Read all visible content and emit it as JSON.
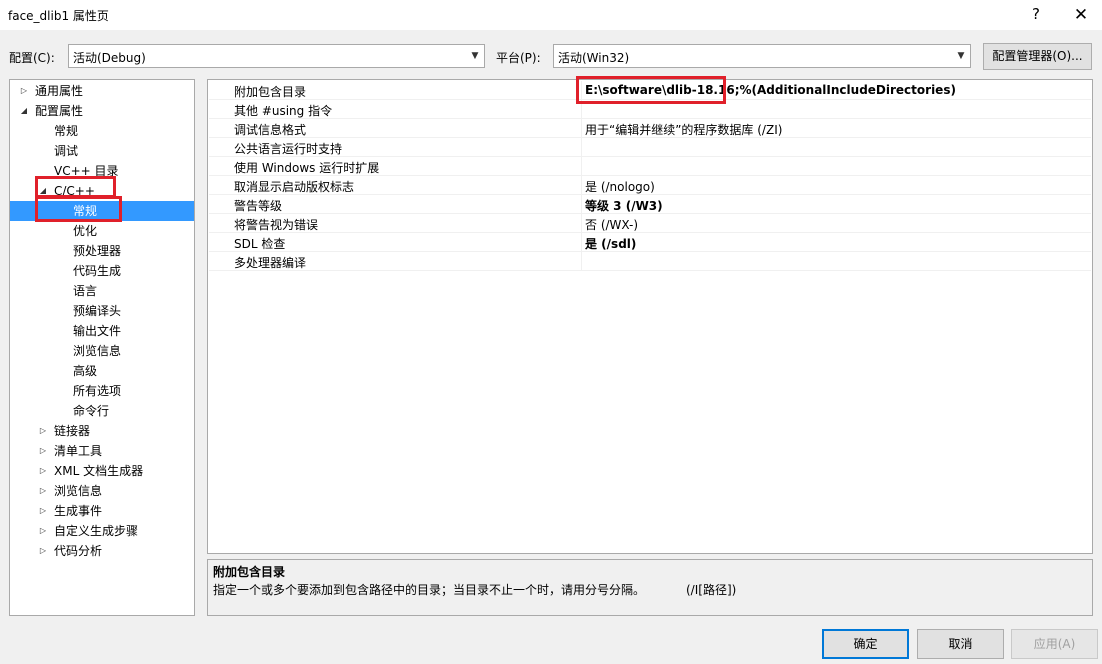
{
  "window": {
    "title": "face_dlib1 属性页",
    "help_label": "?",
    "close_label": "✕"
  },
  "toolbar": {
    "config_label": "配置(C):",
    "config_value": "活动(Debug)",
    "platform_label": "平台(P):",
    "platform_value": "活动(Win32)",
    "config_manager_label": "配置管理器(O)..."
  },
  "tree": {
    "items": [
      {
        "label": "通用属性",
        "expander": "▷"
      },
      {
        "label": "配置属性",
        "expander": "◢"
      },
      {
        "label": "常规",
        "expander": ""
      },
      {
        "label": "调试",
        "expander": ""
      },
      {
        "label": "VC++ 目录",
        "expander": ""
      },
      {
        "label": "C/C++",
        "expander": "◢"
      },
      {
        "label": "常规",
        "expander": ""
      },
      {
        "label": "优化",
        "expander": ""
      },
      {
        "label": "预处理器",
        "expander": ""
      },
      {
        "label": "代码生成",
        "expander": ""
      },
      {
        "label": "语言",
        "expander": ""
      },
      {
        "label": "预编译头",
        "expander": ""
      },
      {
        "label": "输出文件",
        "expander": ""
      },
      {
        "label": "浏览信息",
        "expander": ""
      },
      {
        "label": "高级",
        "expander": ""
      },
      {
        "label": "所有选项",
        "expander": ""
      },
      {
        "label": "命令行",
        "expander": ""
      },
      {
        "label": "链接器",
        "expander": "▷"
      },
      {
        "label": "清单工具",
        "expander": "▷"
      },
      {
        "label": "XML 文档生成器",
        "expander": "▷"
      },
      {
        "label": "浏览信息",
        "expander": "▷"
      },
      {
        "label": "生成事件",
        "expander": "▷"
      },
      {
        "label": "自定义生成步骤",
        "expander": "▷"
      },
      {
        "label": "代码分析",
        "expander": "▷"
      }
    ]
  },
  "grid": {
    "rows": [
      {
        "name": "附加包含目录",
        "value": "E:\\software\\dlib-18.16;%(AdditionalIncludeDirectories)"
      },
      {
        "name": "其他 #using 指令",
        "value": ""
      },
      {
        "name": "调试信息格式",
        "value": "用于“编辑并继续”的程序数据库 (/ZI)"
      },
      {
        "name": "公共语言运行时支持",
        "value": ""
      },
      {
        "name": "使用 Windows 运行时扩展",
        "value": ""
      },
      {
        "name": "取消显示启动版权标志",
        "value": "是 (/nologo)"
      },
      {
        "name": "警告等级",
        "value": "等级 3 (/W3)"
      },
      {
        "name": "将警告视为错误",
        "value": "否 (/WX-)"
      },
      {
        "name": "SDL 检查",
        "value": "是 (/sdl)"
      },
      {
        "name": "多处理器编译",
        "value": ""
      }
    ]
  },
  "description": {
    "title": "附加包含目录",
    "text": "指定一个或多个要添加到包含路径中的目录；当目录不止一个时，请用分号分隔。",
    "switch": "(/I[路径])"
  },
  "buttons": {
    "ok": "确定",
    "cancel": "取消",
    "apply": "应用(A)"
  }
}
